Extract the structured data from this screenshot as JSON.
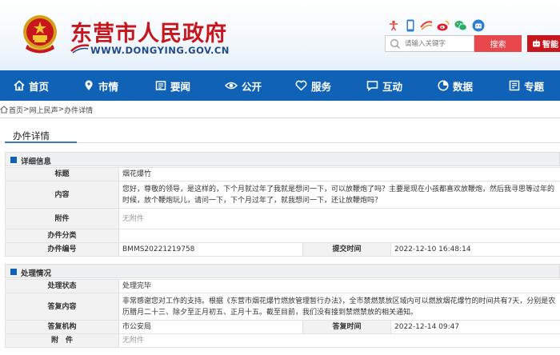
{
  "header": {
    "site_title": "东营市人民政府",
    "site_url": "WWW.DONGYING.GOV.CN",
    "search_placeholder": "请输入关键字",
    "search_button": "搜索",
    "ai_button": "智能"
  },
  "nav": {
    "items": [
      {
        "label": "首页",
        "icon": "home-icon"
      },
      {
        "label": "市情",
        "icon": "pin-icon"
      },
      {
        "label": "要闻",
        "icon": "news-icon"
      },
      {
        "label": "公开",
        "icon": "eye-icon"
      },
      {
        "label": "服务",
        "icon": "heart-icon"
      },
      {
        "label": "互动",
        "icon": "chat-icon"
      },
      {
        "label": "数据",
        "icon": "chart-icon"
      },
      {
        "label": "专题",
        "icon": "topic-icon"
      }
    ]
  },
  "breadcrumb": {
    "home": "首页",
    "sep1": ">",
    "level2": "网上民声",
    "sep2": ">",
    "current": "办件详情"
  },
  "page_tab": "办件详情",
  "detail": {
    "heading": "详细信息",
    "title_label": "标题",
    "title_value": "烟花爆竹",
    "content_label": "内容",
    "content_value": "您好，尊敬的领导，是这样的，下个月就过年了我就是想问一下，可以放鞭炮了吗？主要是现在小孩都喜欢放鞭炮，然后我寻思等过年的时候，放个鞭炮玩儿，请问一下，下个月过年了，就我想问一下，还让放鞭炮吗？",
    "attach_label": "附件",
    "attach_value": "无附件",
    "category_label": "办件分类",
    "category_value": "",
    "number_label": "办件编号",
    "number_value": "BMMS20221219758",
    "submit_label": "提交时间",
    "submit_value": "2022-12-10 16:48:14"
  },
  "process": {
    "heading": "处理情况",
    "status_label": "处理状态",
    "status_value": "处理完毕",
    "reply_label": "答复内容",
    "reply_value": "非常感谢您对工作的支持。根据《东营市烟花爆竹燃放管理暂行办法》，全市禁燃禁放区域内可以燃放烟花爆竹的时间共有7天，分别是农历腊月二十三、除夕至正月初五、正月十五。截至目前，我们没有接到禁燃禁放的相关通知。",
    "org_label": "答复机构",
    "org_value": "市公安局",
    "time_label": "答复时间",
    "time_value": "2022-12-14 09:47",
    "attach_label": "附　件",
    "attach_value": "无附件"
  },
  "colors": {
    "nav_bg": "#1062b6",
    "title_red": "#c8161d",
    "search_btn": "#e8474c"
  }
}
